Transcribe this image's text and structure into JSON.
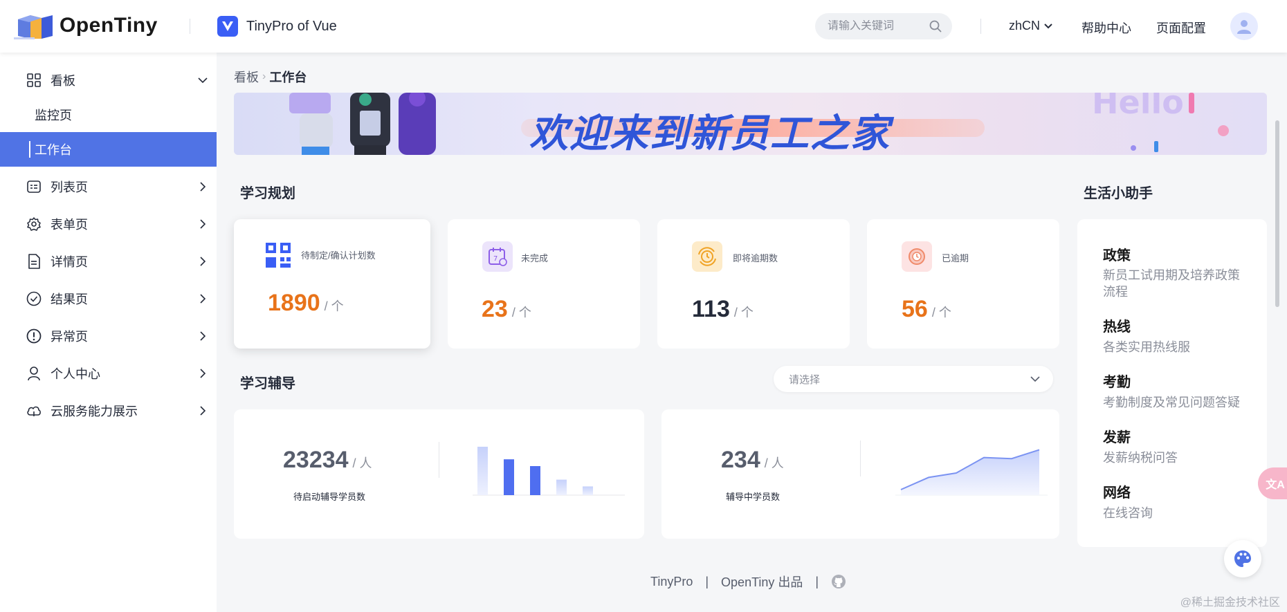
{
  "header": {
    "brand": "OpenTiny",
    "app_title": "TinyPro of Vue",
    "search_placeholder": "请输入关键词",
    "language": "zhCN",
    "help_center": "帮助中心",
    "page_config": "页面配置"
  },
  "sidebar": {
    "items": [
      {
        "label": "看板"
      },
      {
        "label": "监控页"
      },
      {
        "label": "工作台"
      },
      {
        "label": "列表页"
      },
      {
        "label": "表单页"
      },
      {
        "label": "详情页"
      },
      {
        "label": "结果页"
      },
      {
        "label": "异常页"
      },
      {
        "label": "个人中心"
      },
      {
        "label": "云服务能力展示"
      }
    ]
  },
  "breadcrumb": {
    "parent": "看板",
    "current": "工作台"
  },
  "banner": {
    "text": "欢迎来到新员工之家"
  },
  "study_plan": {
    "title": "学习规划",
    "cards": [
      {
        "label": "待制定/确认计划数",
        "value": "1890",
        "unit": "/ 个",
        "color": "#e8731a"
      },
      {
        "label": "未完成",
        "value": "23",
        "unit": "/ 个",
        "color": "#e8731a"
      },
      {
        "label": "即将逾期数",
        "value": "113",
        "unit": "/ 个",
        "color": "#252b3a"
      },
      {
        "label": "已逾期",
        "value": "56",
        "unit": "/ 个",
        "color": "#e8731a"
      }
    ]
  },
  "study_guide": {
    "title": "学习辅导",
    "select_placeholder": "请选择",
    "card1": {
      "value": "23234",
      "unit": "/ 人",
      "caption": "待启动辅导学员数"
    },
    "card2": {
      "value": "234",
      "unit": "/ 人",
      "caption": "辅导中学员数"
    }
  },
  "helper": {
    "title": "生活小助手",
    "items": [
      {
        "title": "政策",
        "desc": "新员工试用期及培养政策流程"
      },
      {
        "title": "热线",
        "desc": "各类实用热线服"
      },
      {
        "title": "考勤",
        "desc": "考勤制度及常见问题答疑"
      },
      {
        "title": "发薪",
        "desc": "发薪纳税问答"
      },
      {
        "title": "网络",
        "desc": "在线咨询"
      }
    ]
  },
  "footer": {
    "left": "TinyPro",
    "middle": "OpenTiny 出品"
  },
  "watermark": "@稀土掘金技术社区",
  "floating": {
    "translate_label": "文A"
  },
  "chart_data": [
    {
      "type": "bar",
      "values": [
        100,
        74,
        60,
        32,
        18
      ],
      "ylim": [
        0,
        100
      ]
    },
    {
      "type": "area",
      "values": [
        10,
        32,
        40,
        68,
        66,
        82
      ],
      "ylim": [
        0,
        100
      ]
    }
  ],
  "colors": {
    "accent": "#5073e5",
    "orange": "#e8731a"
  }
}
